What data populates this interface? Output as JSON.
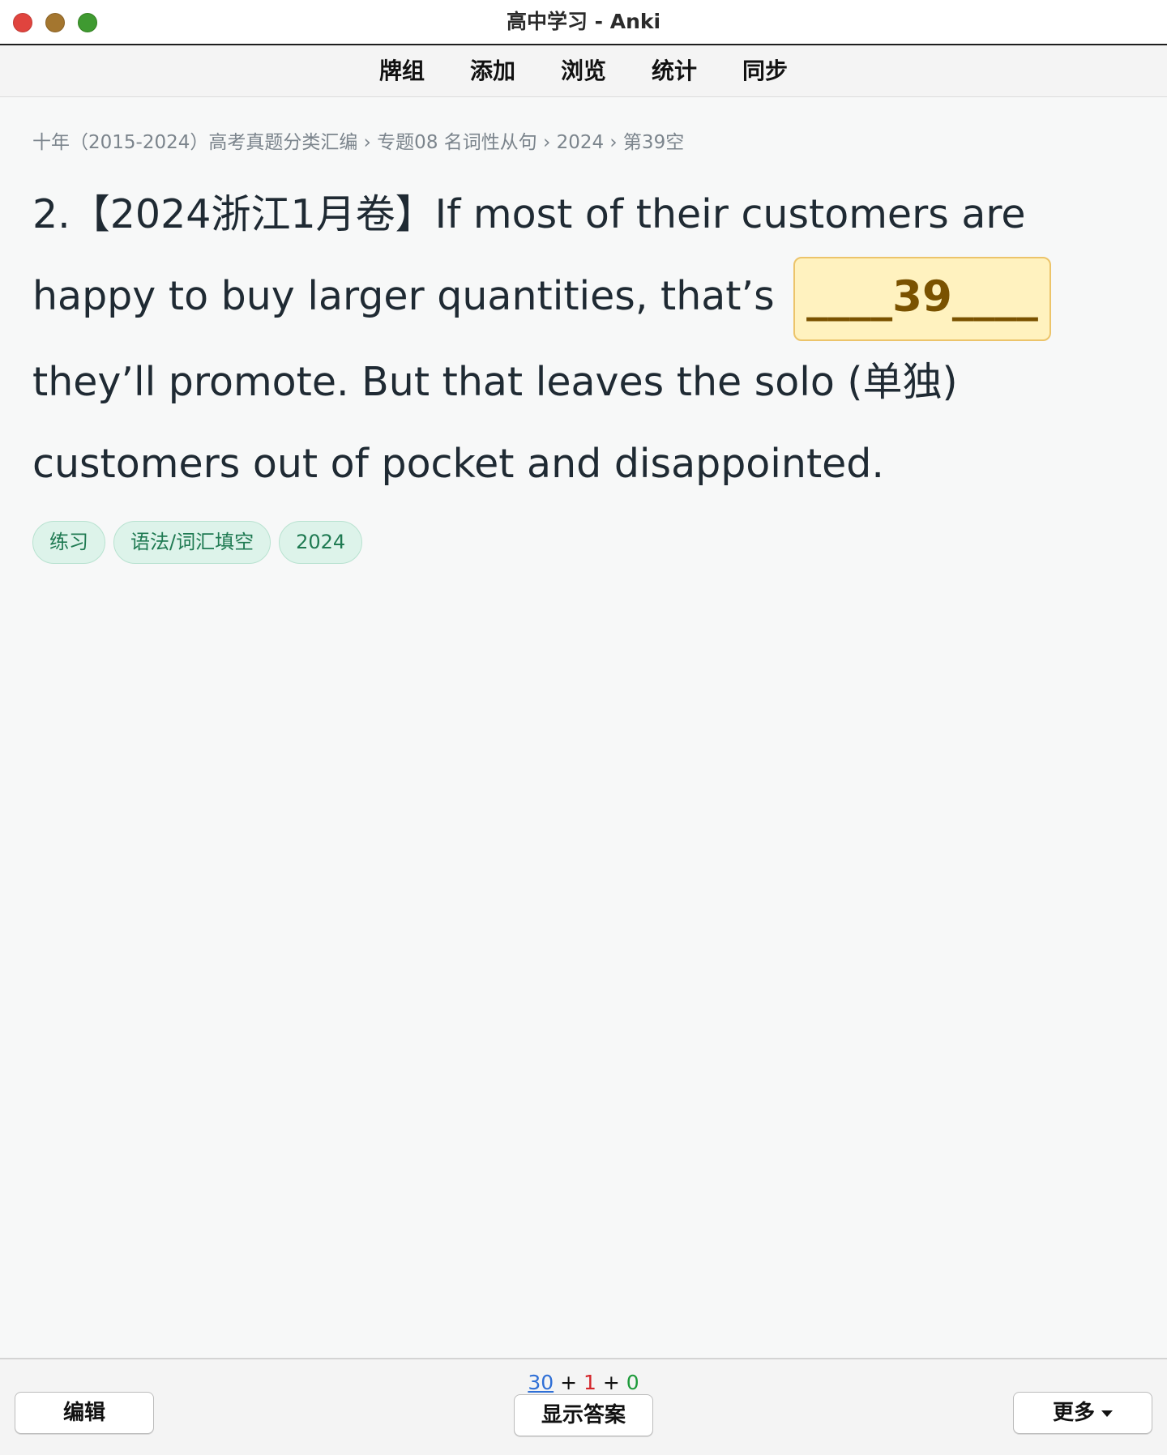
{
  "window": {
    "title": "高中学习 - Anki"
  },
  "toolbar": {
    "items": [
      "牌组",
      "添加",
      "浏览",
      "统计",
      "同步"
    ]
  },
  "card": {
    "breadcrumb": "十年（2015-2024）高考真题分类汇编 › 专题08 名词性从句 › 2024 › 第39空",
    "question_before": "2.【2024浙江1月卷】If most of their customers are happy to buy larger quantities, that’s ",
    "blank": "____39____",
    "question_after": " they’ll promote. But that leaves the solo (单独) customers out of pocket and disappointed.",
    "tags": [
      "练习",
      "语法/词汇填空",
      "2024"
    ]
  },
  "bottom": {
    "counts": {
      "new": "30",
      "plus": "+",
      "learning": "1",
      "review": "0"
    },
    "edit_label": "编辑",
    "show_answer_label": "显示答案",
    "more_label": "更多"
  },
  "colors": {
    "blank_bg": "#fff2bf",
    "blank_border": "#ecc46a",
    "tag_bg": "#ddf3ea",
    "tag_text": "#1f7a52",
    "new_count": "#2f6fd6",
    "learning_count": "#d4262b",
    "review_count": "#1d9a3a"
  }
}
